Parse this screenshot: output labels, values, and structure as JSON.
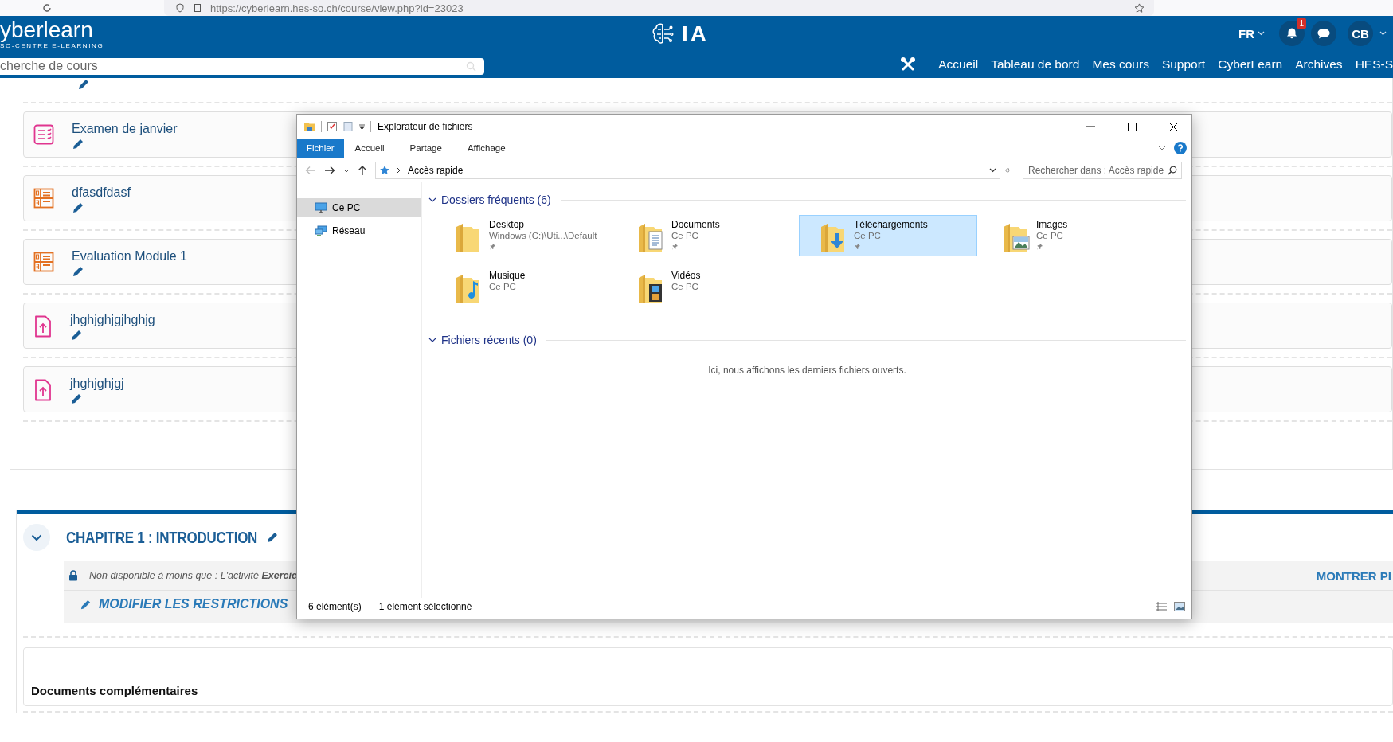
{
  "browser": {
    "url": "https://cyberlearn.hes-so.ch/course/view.php?id=23023"
  },
  "header": {
    "logo": "yberlearn",
    "logo_sub": "SO-CENTRE E-LEARNING",
    "center_title": "IA",
    "language": "FR",
    "notifications_badge": "1",
    "user_initials": "CB",
    "search": {
      "placeholder": "cherche de cours"
    },
    "nav": [
      "Accueil",
      "Tableau de bord",
      "Mes cours",
      "Support",
      "CyberLearn",
      "Archives",
      "HES-S"
    ]
  },
  "activities": [
    {
      "kind": "quiz",
      "title": "Examen de janvier"
    },
    {
      "kind": "qa",
      "title": "dfasdfdasf"
    },
    {
      "kind": "qa",
      "title": "Evaluation Module 1"
    },
    {
      "kind": "upload",
      "title": "jhghjghjgjhghjg"
    },
    {
      "kind": "upload",
      "title": "jhghjghjgj"
    }
  ],
  "chapter": {
    "title": "CHAPITRE 1 : INTRODUCTION",
    "restriction": "Non disponible à moins que : L'activité **Exercic**",
    "edit_restrictions": "MODIFIER LES RESTRICTIONS",
    "show_more": "MONTRER PI"
  },
  "documents": {
    "title": "Documents complémentaires"
  },
  "explorer": {
    "title": "Explorateur de fichiers",
    "tabs": [
      {
        "label": "Fichier",
        "selected": true
      },
      {
        "label": "Accueil",
        "selected": false
      },
      {
        "label": "Partage",
        "selected": false
      },
      {
        "label": "Affichage",
        "selected": false
      }
    ],
    "address": "Accès rapide",
    "search": {
      "placeholder": "Rechercher dans : Accès rapide"
    },
    "nav": [
      {
        "kind": "pc",
        "label": "Ce PC",
        "selected": true
      },
      {
        "kind": "network",
        "label": "Réseau",
        "selected": false
      }
    ],
    "frequent": {
      "title": "Dossiers fréquents (6)",
      "folders": [
        {
          "kind": "plain",
          "name": "Desktop",
          "location": "Windows (C:)\\Uti...\\Default",
          "pinned": true,
          "selected": false
        },
        {
          "kind": "documents",
          "name": "Documents",
          "location": "Ce PC",
          "pinned": true,
          "selected": false
        },
        {
          "kind": "downloads",
          "name": "Téléchargements",
          "location": "Ce PC",
          "pinned": true,
          "selected": true
        },
        {
          "kind": "pictures",
          "name": "Images",
          "location": "Ce PC",
          "pinned": true,
          "selected": false
        },
        {
          "kind": "music",
          "name": "Musique",
          "location": "Ce PC",
          "pinned": false,
          "selected": false
        },
        {
          "kind": "videos",
          "name": "Vidéos",
          "location": "Ce PC",
          "pinned": false,
          "selected": false
        }
      ]
    },
    "recent": {
      "title": "Fichiers récents (0)",
      "empty_text": "Ici, nous affichons les derniers fichiers ouverts."
    },
    "status": [
      "6 élément(s)",
      "1 élément sélectionné"
    ]
  }
}
